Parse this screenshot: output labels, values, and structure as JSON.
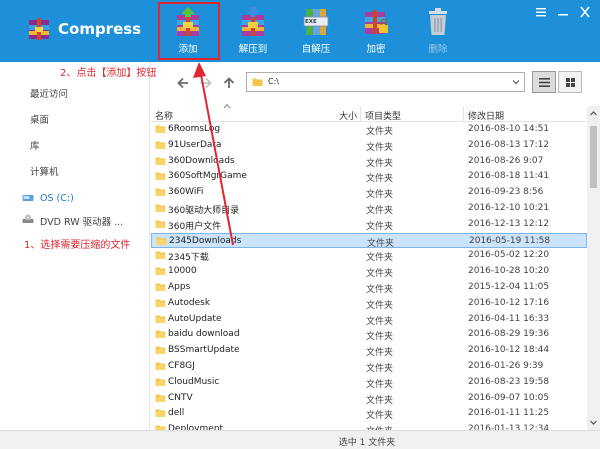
{
  "app": {
    "title": "Compress"
  },
  "toolbar": {
    "add_label": "添加",
    "extract_label": "解压到",
    "sfx_label": "自解压",
    "encrypt_label": "加密",
    "delete_label": "删除",
    "sfx_badge": "EXE"
  },
  "sidebar": {
    "recent": "最近访问",
    "desktop": "桌面",
    "library": "库",
    "computer": "计算机",
    "drives": [
      {
        "label": "OS (C:)"
      },
      {
        "label": "DVD RW 驱动器 ..."
      }
    ]
  },
  "nav": {
    "path": "C:\\"
  },
  "columns": {
    "name": "名称",
    "size": "大小",
    "type": "项目类型",
    "modified": "修改日期"
  },
  "files": [
    {
      "name": "6RoomsLog",
      "type": "文件夹",
      "date": "2016-08-10 14:51",
      "selected": false
    },
    {
      "name": "91UserData",
      "type": "文件夹",
      "date": "2016-08-13 17:12",
      "selected": false
    },
    {
      "name": "360Downloads",
      "type": "文件夹",
      "date": "2016-08-26 9:07",
      "selected": false
    },
    {
      "name": "360SoftMgrGame",
      "type": "文件夹",
      "date": "2016-08-18 11:41",
      "selected": false
    },
    {
      "name": "360WiFi",
      "type": "文件夹",
      "date": "2016-09-23 8:56",
      "selected": false
    },
    {
      "name": "360驱动大师目录",
      "type": "文件夹",
      "date": "2016-12-10 10:21",
      "selected": false
    },
    {
      "name": "360用户文件",
      "type": "文件夹",
      "date": "2016-12-13 12:12",
      "selected": false
    },
    {
      "name": "2345Downloads",
      "type": "文件夹",
      "date": "2016-05-19 11:58",
      "selected": true
    },
    {
      "name": "2345下载",
      "type": "文件夹",
      "date": "2016-05-02 12:20",
      "selected": false
    },
    {
      "name": "10000",
      "type": "文件夹",
      "date": "2016-10-28 10:20",
      "selected": false
    },
    {
      "name": "Apps",
      "type": "文件夹",
      "date": "2015-12-04 11:05",
      "selected": false
    },
    {
      "name": "Autodesk",
      "type": "文件夹",
      "date": "2016-10-12 17:16",
      "selected": false
    },
    {
      "name": "AutoUpdate",
      "type": "文件夹",
      "date": "2016-04-11 16:33",
      "selected": false
    },
    {
      "name": "baidu download",
      "type": "文件夹",
      "date": "2016-08-29 19:36",
      "selected": false
    },
    {
      "name": "BSSmartUpdate",
      "type": "文件夹",
      "date": "2016-10-12 18:44",
      "selected": false
    },
    {
      "name": "CF8GJ",
      "type": "文件夹",
      "date": "2016-01-26 9:39",
      "selected": false
    },
    {
      "name": "CloudMusic",
      "type": "文件夹",
      "date": "2016-08-23 19:58",
      "selected": false
    },
    {
      "name": "CNTV",
      "type": "文件夹",
      "date": "2016-09-07 10:05",
      "selected": false
    },
    {
      "name": "dell",
      "type": "文件夹",
      "date": "2016-01-11 11:25",
      "selected": false
    },
    {
      "name": "Deployment",
      "type": "文件夹",
      "date": "2016-01-13 12:34",
      "selected": false
    }
  ],
  "status": {
    "text": "选中 1 文件夹"
  },
  "annotations": {
    "step1": "1、选择需要压缩的文件",
    "step2": "2、点击【添加】按钮"
  },
  "colors": {
    "titlebar": "#1e90d9",
    "accent": "#1e7bd0",
    "annotation": "#e0262f",
    "selection": "#cce4fb"
  }
}
